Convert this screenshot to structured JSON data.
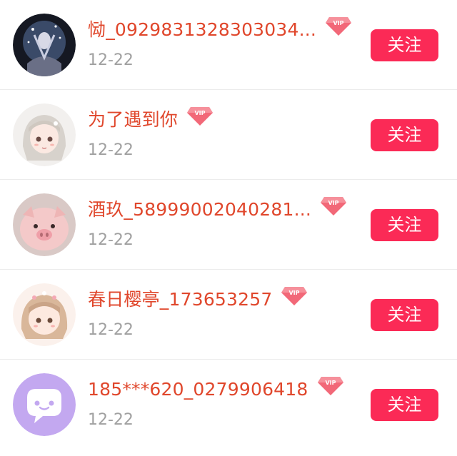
{
  "colors": {
    "name_text": "#e0472c",
    "date_text": "#a0a0a0",
    "follow_button_bg": "#fb2a56",
    "follow_button_text": "#ffffff",
    "vip_badge": "#f26878",
    "divider": "#ececec"
  },
  "users": [
    {
      "name": "恸_0929831328303034...",
      "vip": true,
      "vip_label": "VIP",
      "date": "12-22",
      "follow_label": "关注",
      "avatar_icon": "anime-scene-avatar"
    },
    {
      "name": "为了遇到你",
      "vip": true,
      "vip_label": "VIP",
      "date": "12-22",
      "follow_label": "关注",
      "avatar_icon": "anime-girl-avatar"
    },
    {
      "name": "酒玖_58999002040281...",
      "vip": true,
      "vip_label": "VIP",
      "date": "12-22",
      "follow_label": "关注",
      "avatar_icon": "pink-pig-plush-avatar"
    },
    {
      "name": "春日樱亭_173653257",
      "vip": true,
      "vip_label": "VIP",
      "date": "12-22",
      "follow_label": "关注",
      "avatar_icon": "chibi-girl-avatar"
    },
    {
      "name": "185***620_0279906418",
      "vip": true,
      "vip_label": "VIP",
      "date": "12-22",
      "follow_label": "关注",
      "avatar_icon": "chat-bubble-default-avatar"
    }
  ]
}
